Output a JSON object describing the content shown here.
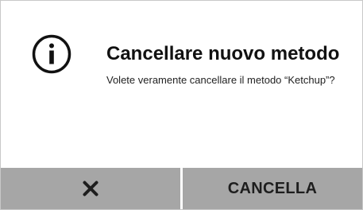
{
  "dialog": {
    "title": "Cancellare nuovo metodo",
    "message": "Volete veramente cancellare il metodo “Ketchup”?",
    "icon": "info-icon"
  },
  "buttons": {
    "cancel_icon": "close-icon",
    "delete_label": "CANCELLA"
  },
  "colors": {
    "button_bar": "#a6a6a6",
    "text": "#111111",
    "background": "#ffffff"
  }
}
